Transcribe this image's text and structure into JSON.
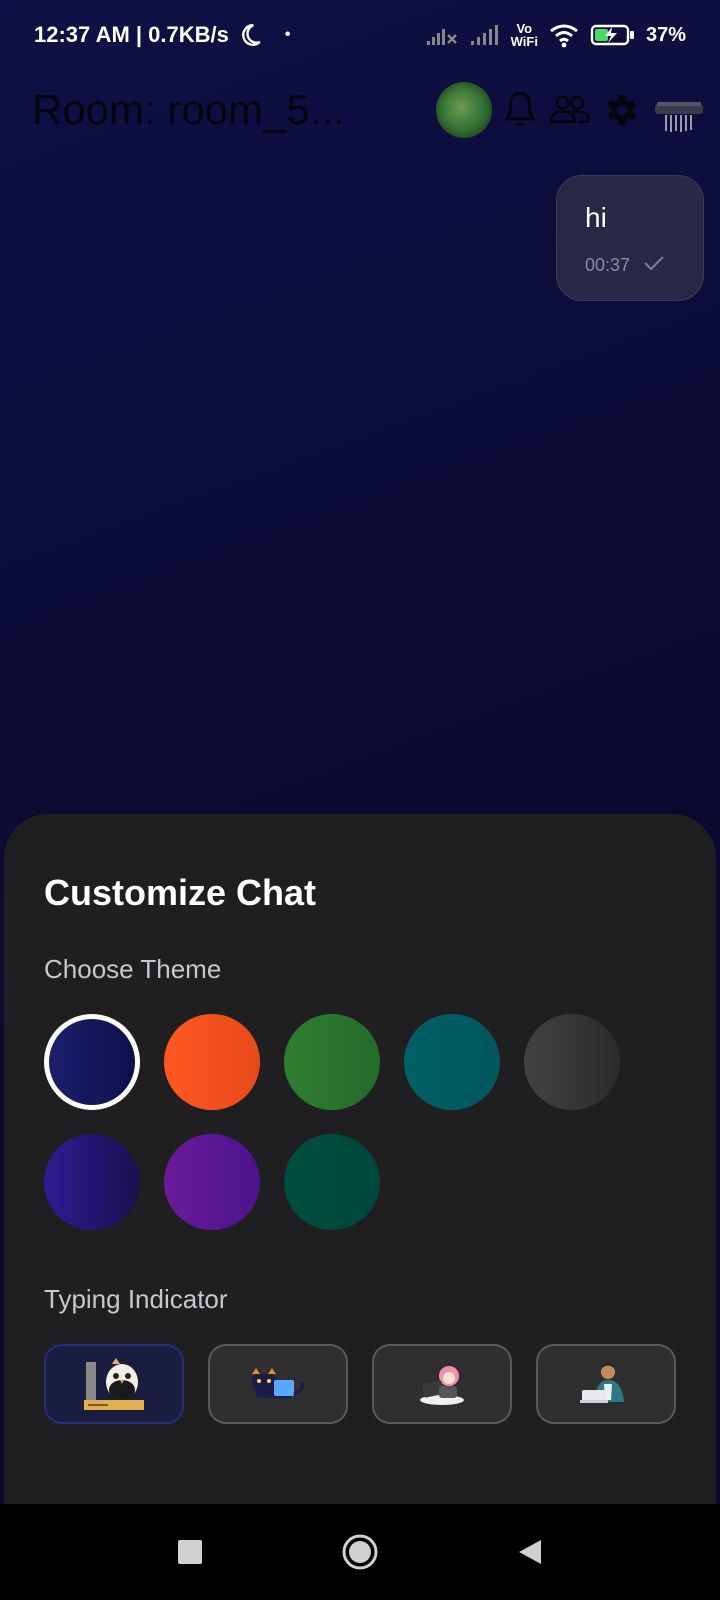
{
  "status_bar": {
    "time_speed": "12:37 AM | 0.7KB/s",
    "dot": "•",
    "battery": "37%",
    "vowifi_top": "Vo",
    "vowifi_bottom": "WiFi"
  },
  "app_bar": {
    "title": "Room: room_5...",
    "icons": [
      "avatar",
      "bell-icon",
      "participants-icon",
      "gear-icon",
      "shredder-icon"
    ]
  },
  "message": {
    "text": "hi",
    "time": "00:37",
    "status_icon": "check-icon"
  },
  "sheet": {
    "title": "Customize Chat",
    "theme_label": "Choose Theme",
    "typing_label": "Typing Indicator",
    "themes": [
      {
        "name": "indigo",
        "from": "#1d1f6e",
        "to": "#0d0f4a",
        "selected": true
      },
      {
        "name": "orange",
        "from": "#ff5722",
        "to": "#e64a19",
        "selected": false
      },
      {
        "name": "green",
        "from": "#2e7d32",
        "to": "#256b2a",
        "selected": false
      },
      {
        "name": "teal",
        "from": "#006064",
        "to": "#00575c",
        "selected": false
      },
      {
        "name": "dark-gray",
        "from": "#424242",
        "to": "#2b2b2b",
        "selected": false
      },
      {
        "name": "deep-purple",
        "from": "#311b92",
        "to": "#1a0f4d",
        "selected": false
      },
      {
        "name": "purple",
        "from": "#6a1b9a",
        "to": "#4a148c",
        "selected": false
      },
      {
        "name": "dark-teal",
        "from": "#004d40",
        "to": "#00473b",
        "selected": false
      }
    ],
    "indicators": [
      {
        "name": "owl-typing",
        "selected": true
      },
      {
        "name": "cat-laptop",
        "selected": false
      },
      {
        "name": "girl-laptop",
        "selected": false
      },
      {
        "name": "man-laptop",
        "selected": false
      }
    ]
  },
  "nav_bar": {
    "icons": [
      "recents-square-icon",
      "home-circle-icon",
      "back-triangle-icon"
    ]
  }
}
